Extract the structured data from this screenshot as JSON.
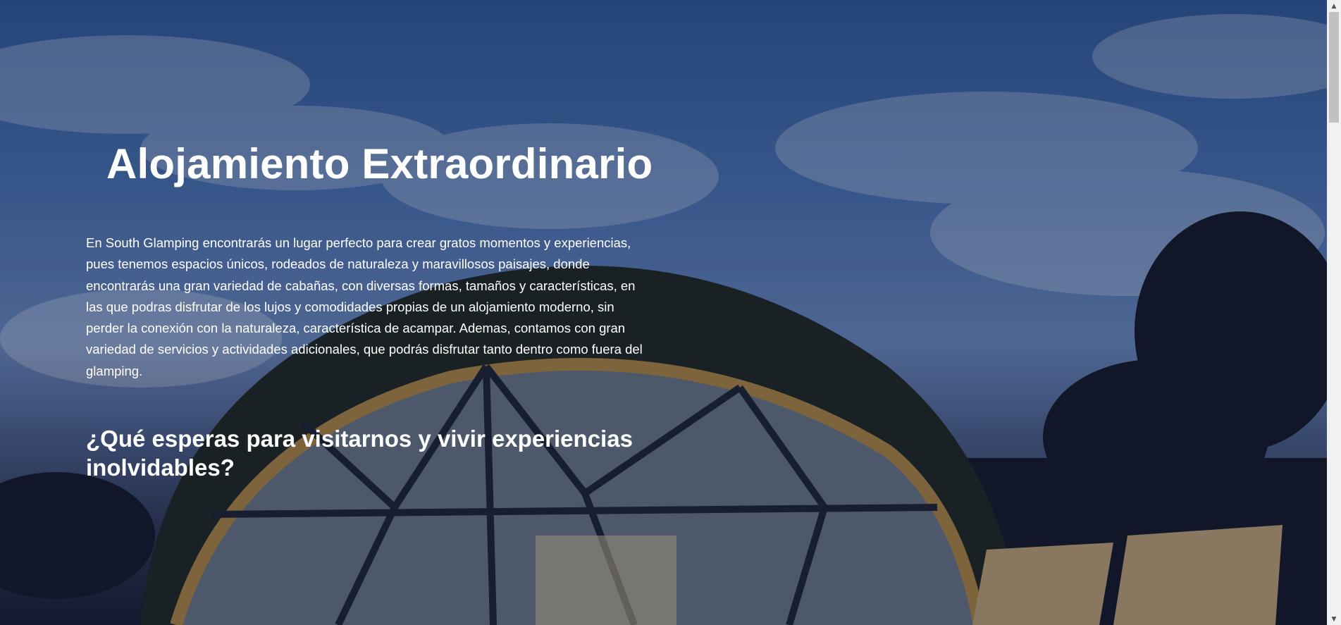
{
  "hero": {
    "title": "Alojamiento Extraordinario",
    "description": "En South Glamping encontrarás un lugar perfecto para crear gratos momentos y experiencias, pues tenemos espacios únicos, rodeados de naturaleza y maravillosos paisajes, donde encontrarás una gran variedad de cabañas, con diversas formas, tamaños y características, en las que podras disfrutar de los lujos y comodidades propias de un alojamiento moderno, sin perder la conexión con la naturaleza, característica de acampar. Ademas, contamos con gran variedad de servicios y actividades adicionales, que podrás disfrutar tanto dentro como fuera del glamping.",
    "subtitle": "¿Qué esperas para visitarnos y vivir experiencias inolvidables?"
  },
  "background": {
    "icon": "geodesic-dome-glamping-image",
    "sky_color": "#3d67a8",
    "overlay_color": "#141c3c"
  },
  "scrollbar": {
    "up_icon": "chevron-up-icon",
    "down_icon": "chevron-down-icon"
  }
}
